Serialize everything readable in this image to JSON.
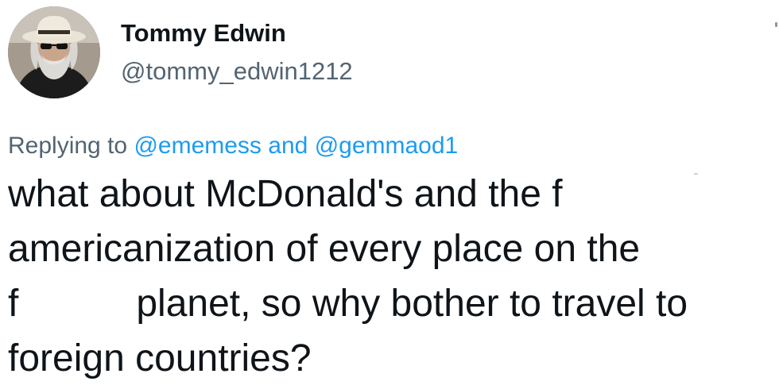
{
  "author": {
    "display_name": "Tommy Edwin",
    "handle": "@tommy_edwin1212",
    "avatar_icon": "user-avatar-cowboy-hat"
  },
  "reply": {
    "prefix": "Replying to",
    "mention_1": "@ememess",
    "joiner": "and",
    "mention_2": "@gemmaod1"
  },
  "tweet": {
    "line_1": "what about McDonald's and the f",
    "line_2": "americanization of every place on the",
    "line_3_start": "f",
    "line_3_end": "planet, so why bother to travel to",
    "line_4": "foreign countries?"
  },
  "colors": {
    "text": "#0f1419",
    "secondary": "#536471",
    "mention": "#1d9bf0"
  }
}
